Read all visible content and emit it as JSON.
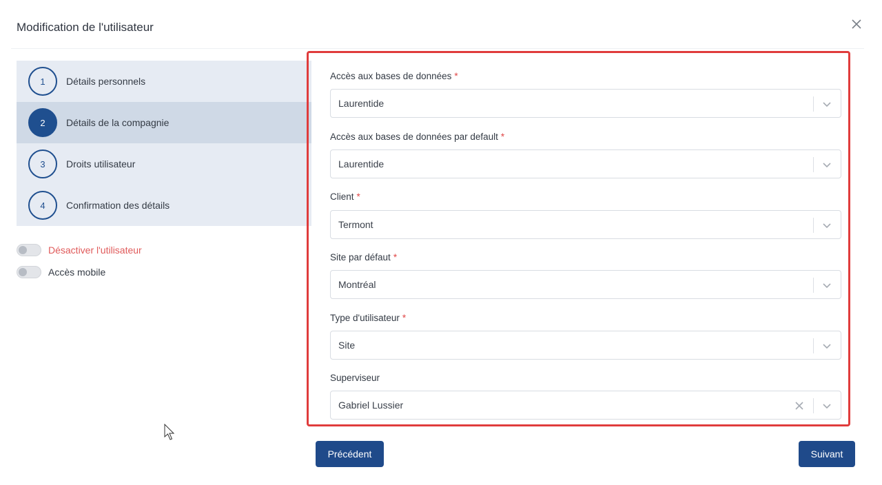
{
  "header": {
    "title": "Modification de l'utilisateur"
  },
  "stepper": {
    "steps": [
      {
        "number": "1",
        "label": "Détails personnels"
      },
      {
        "number": "2",
        "label": "Détails de la compagnie"
      },
      {
        "number": "3",
        "label": "Droits utilisateur"
      },
      {
        "number": "4",
        "label": "Confirmation des détails"
      }
    ],
    "active_step": 2
  },
  "toggles": {
    "deactivate": {
      "label": "Désactiver l'utilisateur",
      "on": false
    },
    "mobile": {
      "label": "Accès mobile",
      "on": false
    }
  },
  "form": {
    "fields": [
      {
        "label": "Accès aux bases de données",
        "required": "*",
        "value": "Laurentide"
      },
      {
        "label": "Accès aux bases de données par default",
        "required": "*",
        "value": "Laurentide"
      },
      {
        "label": "Client",
        "required": "*",
        "value": "Termont"
      },
      {
        "label": "Site par défaut",
        "required": "*",
        "value": "Montréal"
      },
      {
        "label": "Type d'utilisateur",
        "required": "*",
        "value": "Site"
      },
      {
        "label": "Superviseur",
        "value": "Gabriel Lussier"
      }
    ]
  },
  "buttons": {
    "previous": "Précédent",
    "next": "Suivant"
  },
  "colors": {
    "primary": "#1f4a8a",
    "danger": "#e05a5a",
    "highlight_border": "#e03c3c",
    "stepper_bg": "#e6ebf3",
    "stepper_active": "#cfd9e6"
  },
  "icons": {
    "close": "close-icon",
    "dropdown": "chevron-down-icon",
    "clear": "clear-icon"
  }
}
